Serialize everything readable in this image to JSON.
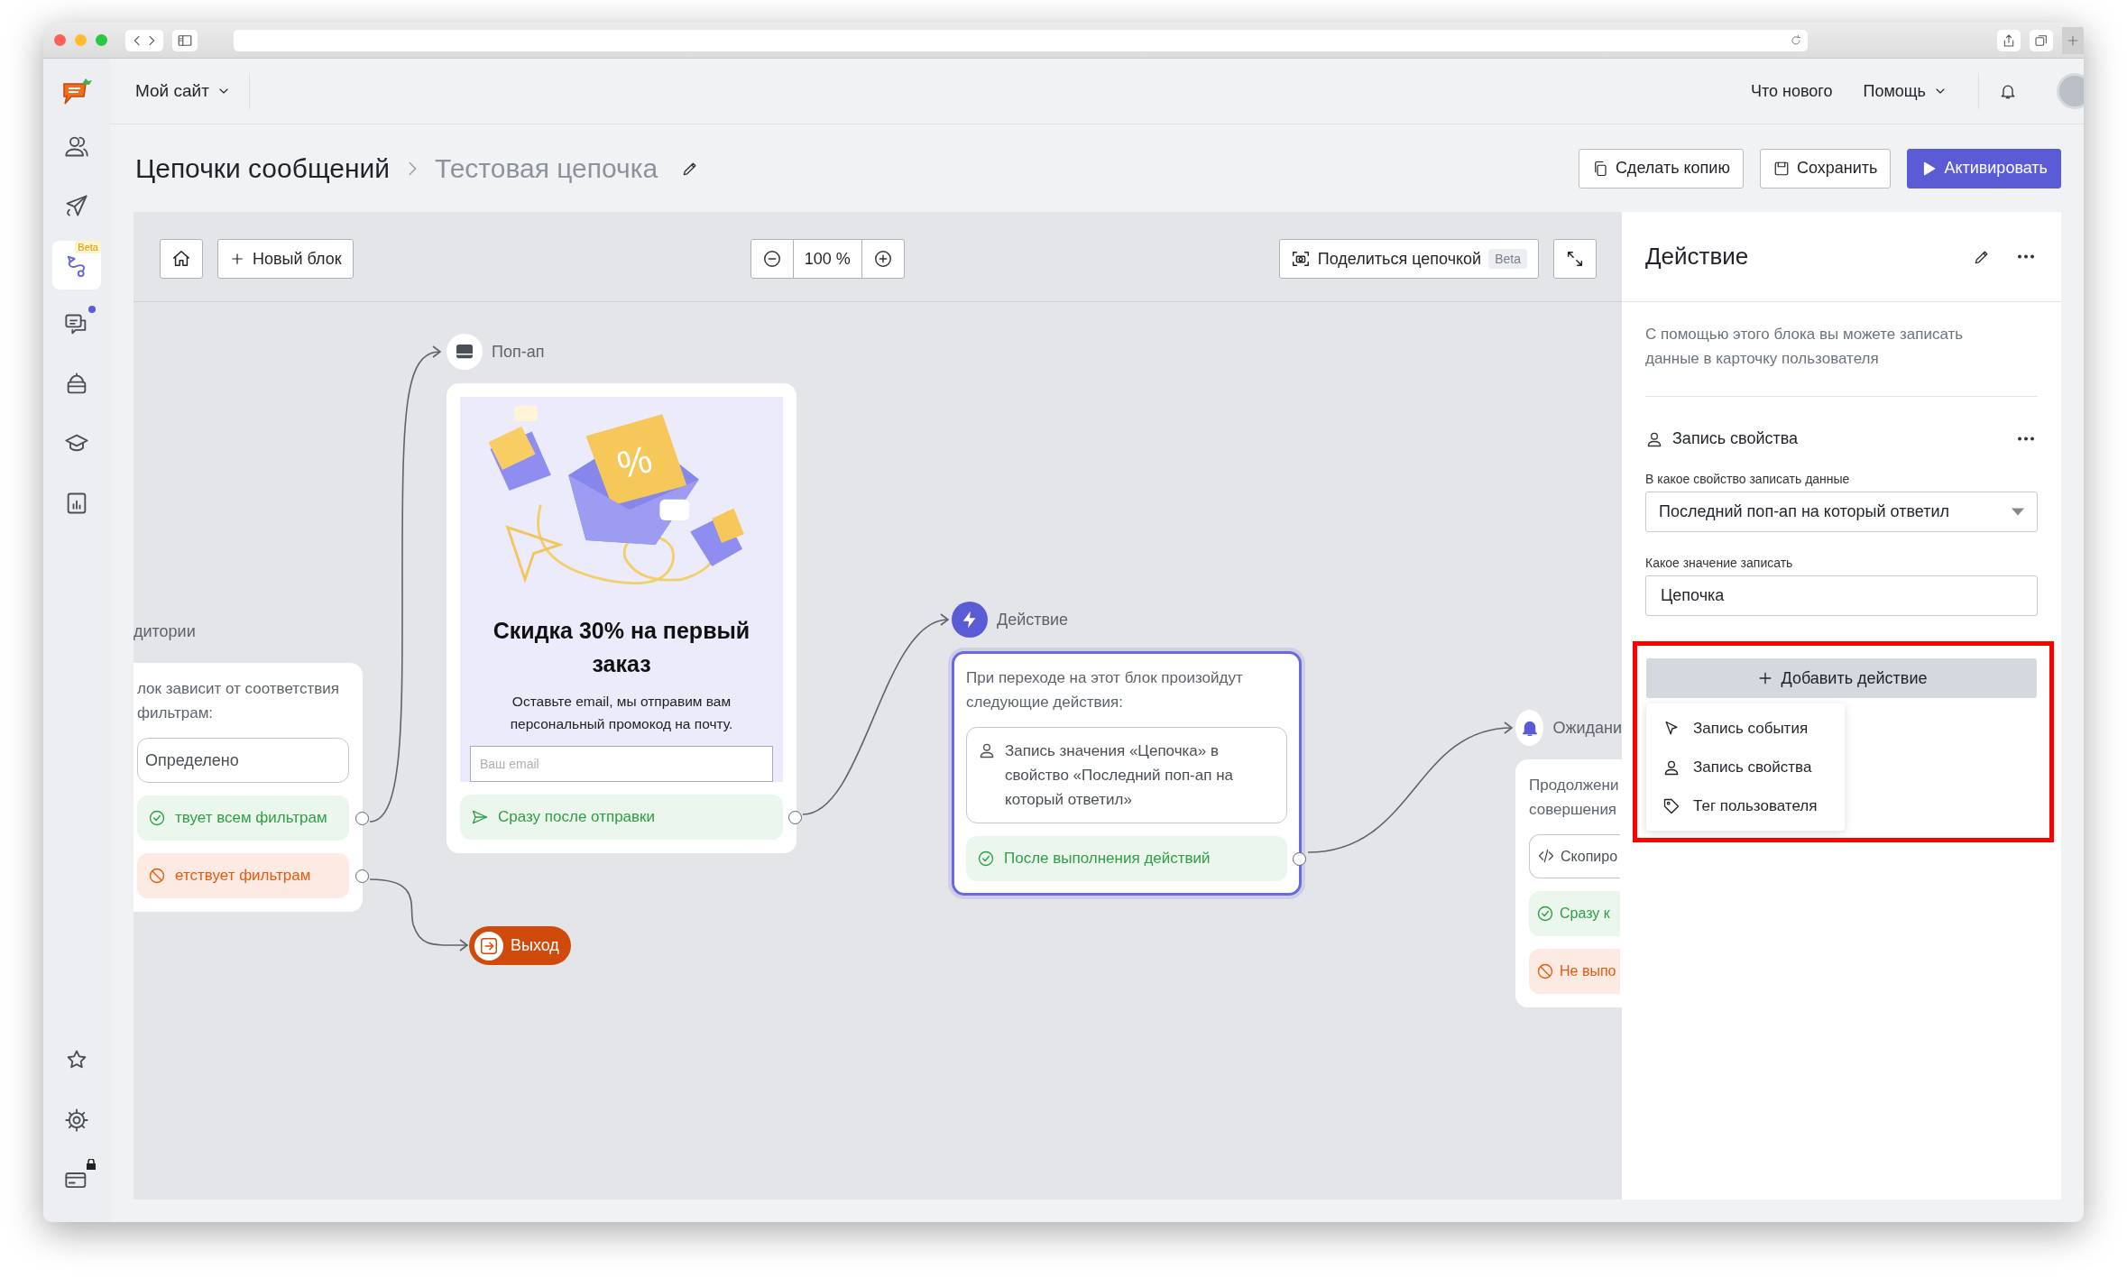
{
  "topbar": {
    "site": "Мой сайт",
    "links": [
      {
        "kind": "link",
        "label": "Что нового"
      },
      {
        "kind": "menu",
        "label": "Помощь"
      }
    ]
  },
  "sidebar": {
    "items": [
      {
        "kind": "contacts",
        "selected": false,
        "dot": false
      },
      {
        "kind": "campaigns",
        "selected": false,
        "dot": false
      },
      {
        "kind": "chains",
        "selected": true,
        "dot": false,
        "badge": "Beta"
      },
      {
        "kind": "chats",
        "selected": false,
        "dot": true
      },
      {
        "kind": "bots",
        "selected": false,
        "dot": false
      },
      {
        "kind": "academy",
        "selected": false,
        "dot": false
      },
      {
        "kind": "reports",
        "selected": false,
        "dot": false
      }
    ],
    "bottom_items": [
      {
        "kind": "integrations",
        "selected": false,
        "locked": false
      },
      {
        "kind": "settings",
        "selected": false,
        "locked": false
      },
      {
        "kind": "billing",
        "selected": false,
        "locked": true
      }
    ]
  },
  "breadcrumb": {
    "section": "Цепочки сообщений",
    "chain": "Тестовая цепочка"
  },
  "actions": [
    {
      "kind": "copy",
      "label": "Сделать копию"
    },
    {
      "kind": "save",
      "label": "Сохранить"
    },
    {
      "kind": "activate",
      "label": "Активировать"
    }
  ],
  "canvas": {
    "toolbar": {
      "new_block": "Новый блок",
      "zoom": "100 %",
      "share": "Поделиться цепочкой",
      "share_badge": "Beta"
    },
    "nodes": [
      {
        "kind": "filter",
        "selected": false,
        "title": "дитории",
        "description": "лок зависит от соответствия фильтрам:",
        "fields": [
          "Определено"
        ],
        "outputs": [
          {
            "kind": "success",
            "label": "твует всем фильтрам"
          },
          {
            "kind": "failure",
            "label": "етствует фильтрам"
          }
        ]
      },
      {
        "kind": "popup",
        "selected": false,
        "title": "Поп-ап",
        "preview": {
          "badge": "%",
          "heading": "Скидка 30% на первый заказ",
          "text": "Оставьте email, мы отправим вам персональный промокод на почту.",
          "placeholder": "Ваш email"
        },
        "outputs": [
          {
            "kind": "sent",
            "label": "Сразу после отправки"
          }
        ]
      },
      {
        "kind": "action",
        "selected": true,
        "title": "Действие",
        "description": "При переходе на этот блок произойдут следующие действия:",
        "steps": [
          {
            "kind": "property",
            "label": "Запись значения «Цепочка» в свойство «Последний поп-ап на который ответил»"
          }
        ],
        "outputs": [
          {
            "kind": "success",
            "label": "После выполнения действий"
          }
        ]
      },
      {
        "kind": "wait",
        "selected": false,
        "title": "Ожидани",
        "description": "Продолжени совершения",
        "steps": [
          {
            "kind": "code",
            "label": "Скопиро"
          }
        ],
        "outputs": [
          {
            "kind": "success",
            "label": "Сразу к"
          },
          {
            "kind": "failure",
            "label": "Не выпо"
          }
        ]
      },
      {
        "kind": "exit",
        "selected": false,
        "title": "Выход"
      }
    ]
  },
  "panel": {
    "title": "Действие",
    "description": "С помощью этого блока вы можете записать данные в карточку пользователя",
    "section": {
      "kind": "property",
      "title": "Запись свойства"
    },
    "fields": [
      {
        "kind": "select",
        "label": "В какое свойство записать данные",
        "value": "Последний поп-ап на который ответил"
      },
      {
        "kind": "text",
        "label": "Какое значение записать",
        "value": "Цепочка"
      }
    ],
    "add_button": "Добавить действие",
    "add_highlighted": true,
    "menu": [
      {
        "kind": "event",
        "label": "Запись события"
      },
      {
        "kind": "property",
        "label": "Запись свойства"
      },
      {
        "kind": "tag",
        "label": "Тег пользователя"
      }
    ]
  }
}
